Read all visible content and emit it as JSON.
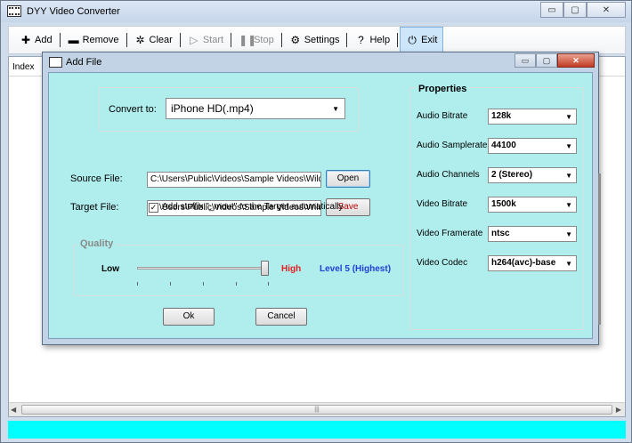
{
  "app": {
    "title": "DYY Video Converter",
    "window_buttons": {
      "minimize": "▭",
      "maximize": "▢",
      "close": "✕"
    }
  },
  "toolbar": {
    "add": "Add",
    "remove": "Remove",
    "clear": "Clear",
    "start": "Start",
    "stop": "Stop",
    "settings": "Settings",
    "help": "Help",
    "exit": "Exit"
  },
  "list": {
    "column_index": "Index"
  },
  "dialog": {
    "title": "Add File",
    "convert_to_label": "Convert to:",
    "convert_to_value": "iPhone HD(.mp4)",
    "source_file_label": "Source File:",
    "source_file_value": "C:\\Users\\Public\\Videos\\Sample Videos\\Wildlife.v",
    "open_button": "Open",
    "target_file_label": "Target File:",
    "target_file_value": "C:\\Users\\Public\\Videos\\Sample Videos\\Wildlife_",
    "save_button": "Save",
    "add_stuffix_label": "Add stuffix \"_mout\" to the Target automatically",
    "add_stuffix_checked": true,
    "quality": {
      "legend": "Quality",
      "low_label": "Low",
      "high_label": "High",
      "level_label": "Level 5 (Highest)",
      "level_fraction": 1.0
    },
    "ok_button": "Ok",
    "cancel_button": "Cancel",
    "properties": {
      "title": "Properties",
      "items": [
        {
          "label": "Audio Bitrate",
          "value": "128k"
        },
        {
          "label": "Audio Samplerate",
          "value": "44100"
        },
        {
          "label": "Audio Channels",
          "value": "2 (Stereo)"
        },
        {
          "label": "Video Bitrate",
          "value": "1500k"
        },
        {
          "label": "Video Framerate",
          "value": "ntsc"
        },
        {
          "label": "Video Codec",
          "value": "h264(avc)-base"
        }
      ]
    }
  },
  "colors": {
    "dialog_body": "#b0eded",
    "status_bar": "#00ffff",
    "quality_high": "#e81d1d",
    "quality_level": "#1f3fd6"
  }
}
